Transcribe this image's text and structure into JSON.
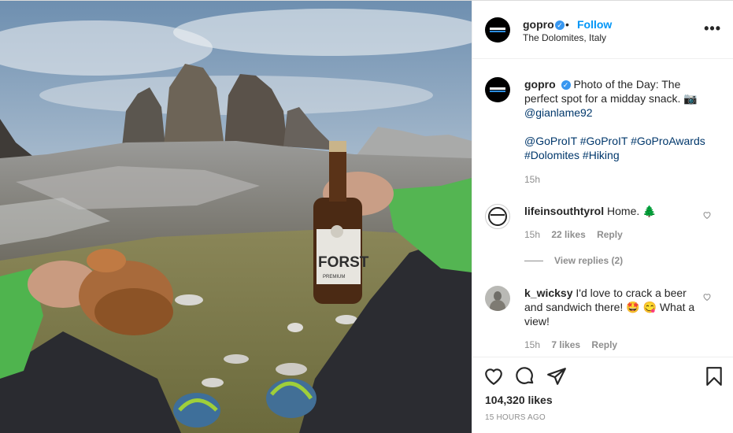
{
  "post": {
    "username": "gopro",
    "follow_label": "Follow",
    "separator": "•",
    "location": "The Dolomites, Italy",
    "more_label": "•••",
    "caption": {
      "username": "gopro",
      "text": "Photo of the Day: The perfect spot for a midday snack. 📷",
      "mention": "@gianlame92",
      "hashtags_line1": "@GoProIT #GoProIT #GoProAwards",
      "hashtags_line2": "#Dolomites #Hiking",
      "time": "15h"
    },
    "comments": [
      {
        "username": "lifeinsouthtyrol",
        "text": "Home. 🌲",
        "time": "15h",
        "likes": "22 likes",
        "reply": "Reply",
        "view_replies": "View replies (2)"
      },
      {
        "username": "k_wicksy",
        "text": "I'd love to crack a beer and sandwich there! 🤩 😋 What a view!",
        "time": "15h",
        "likes": "7 likes",
        "reply": "Reply"
      }
    ],
    "likes_count": "104,320 likes",
    "posted_ago": "15 HOURS AGO",
    "bottle_label": "FORST",
    "bottle_sublabel": "PREMIUM"
  },
  "colors": {
    "link_blue": "#0095f6",
    "verified_blue": "#3897f0",
    "muted_gray": "#8e8e8e",
    "hashtag": "#00376b"
  },
  "icons": [
    "verified-badge-icon",
    "more-options-icon",
    "heart-icon",
    "comment-icon",
    "share-icon",
    "bookmark-icon",
    "small-heart-icon"
  ]
}
